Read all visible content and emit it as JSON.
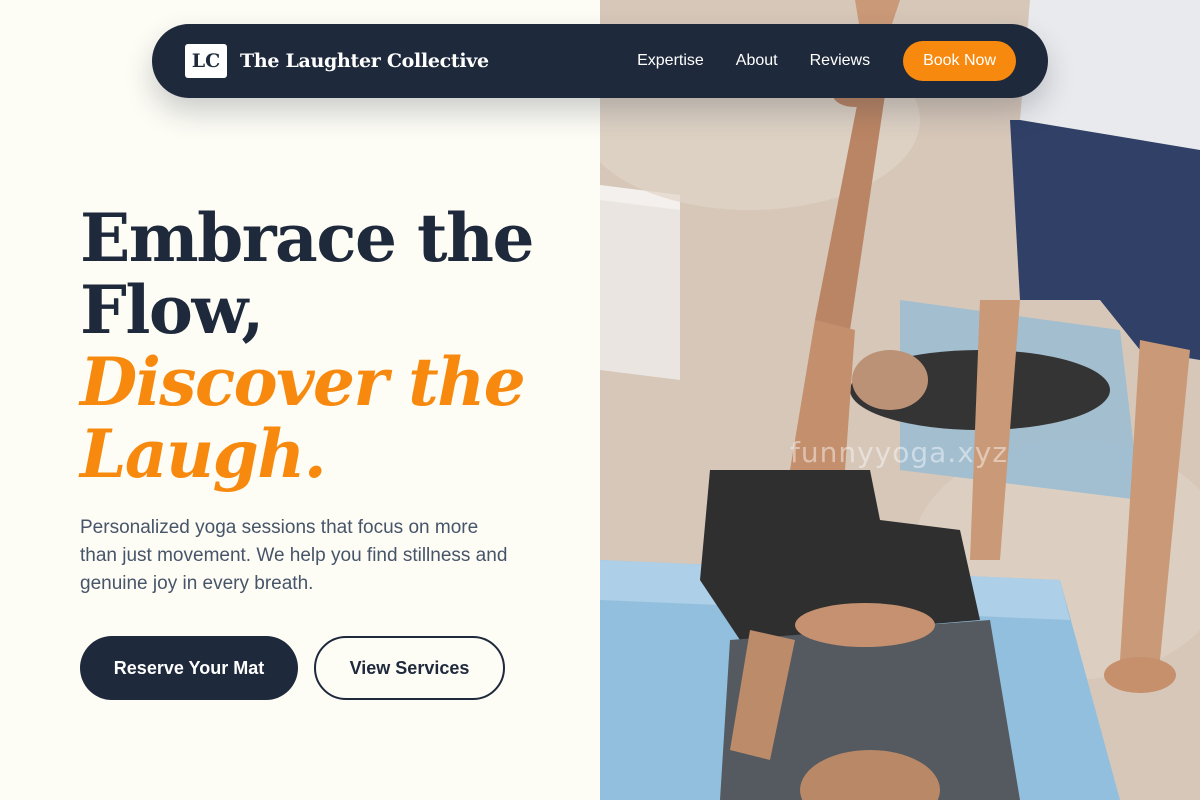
{
  "brand": {
    "logo_initials": "LC",
    "name": "The Laughter Collective"
  },
  "nav": {
    "links": [
      "Expertise",
      "About",
      "Reviews"
    ],
    "cta_label": "Book Now"
  },
  "hero": {
    "headline_line1": "Embrace the",
    "headline_line2": "Flow,",
    "headline_accent1": "Discover the",
    "headline_accent2": "Laugh.",
    "subtitle": "Personalized yoga sessions that focus on more than just movement. We help you find stillness and genuine joy in every breath.",
    "primary_cta": "Reserve Your Mat",
    "secondary_cta": "View Services"
  },
  "photo": {
    "watermark": "funnyyoga.xyz",
    "subject": "yoga-class-photo"
  },
  "colors": {
    "navy": "#1e293b",
    "accent_orange": "#f78a0e",
    "background": "#fdfcf5",
    "body_text": "#475569"
  }
}
